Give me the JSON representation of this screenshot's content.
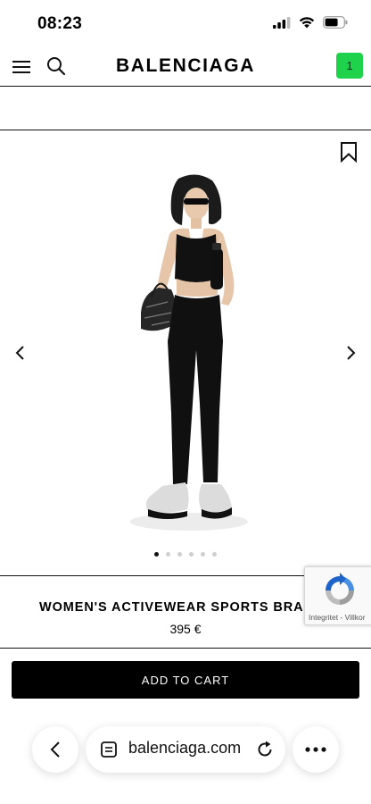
{
  "status_bar": {
    "time": "08:23",
    "icons": [
      "signal-icon",
      "wifi-icon",
      "battery-icon"
    ]
  },
  "header": {
    "brand": "BALENCIAGA",
    "cart_count": "1",
    "icons": [
      "menu-icon",
      "search-icon"
    ],
    "cart_color": "#1fd24b"
  },
  "gallery": {
    "icons": [
      "bookmark-icon",
      "chevron-left-icon",
      "chevron-right-icon"
    ],
    "slide_count": 6,
    "active_slide": 1
  },
  "product": {
    "name": "WOMEN'S ACTIVEWEAR SPORTS BRA IN BLACK",
    "price": "395 €"
  },
  "recaptcha": {
    "text": "Integritet - Villkor"
  },
  "actions": {
    "add_to_cart": "ADD TO CART"
  },
  "browser": {
    "url": "balenciaga.com",
    "icons": [
      "back-icon",
      "tabs-icon",
      "reload-icon",
      "more-icon"
    ]
  }
}
